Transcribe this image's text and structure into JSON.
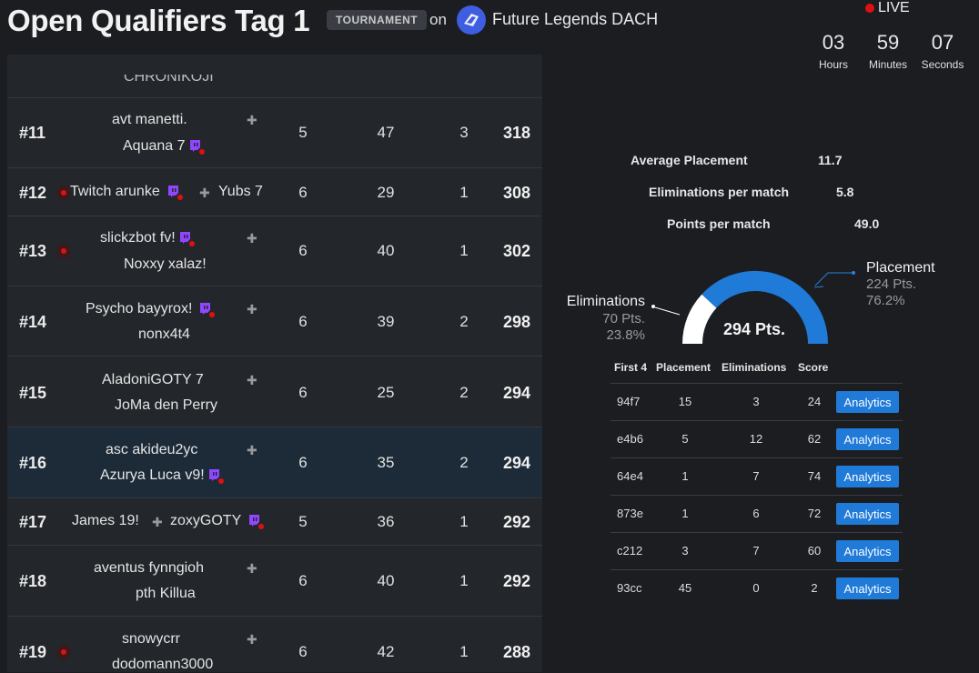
{
  "header": {
    "title": "Open Qualifiers Tag 1",
    "badge": "TOURNAMENT",
    "on_text": "on",
    "org_name": "Future Legends DACH",
    "live_label": "LIVE",
    "countdown": [
      {
        "value": "03",
        "label": "Hours"
      },
      {
        "value": "59",
        "label": "Minutes"
      },
      {
        "value": "07",
        "label": "Seconds"
      }
    ]
  },
  "leaderboard": {
    "partial_top_name": "CHRONIKOJI",
    "rows": [
      {
        "rank": "#11",
        "p1": "avt manetti.",
        "p2": "Aquana 7",
        "col1": "5",
        "col2": "47",
        "col3": "3",
        "score": "318"
      },
      {
        "rank": "#12",
        "p1": "Twitch arunke",
        "p2": "Yubs 7",
        "col1": "6",
        "col2": "29",
        "col3": "1",
        "score": "308"
      },
      {
        "rank": "#13",
        "p1": "slickzbot fv!",
        "p2": "Noxxy xalaz!",
        "col1": "6",
        "col2": "40",
        "col3": "1",
        "score": "302"
      },
      {
        "rank": "#14",
        "p1": "Psycho bayyrox!",
        "p2": "nonx4t4",
        "col1": "6",
        "col2": "39",
        "col3": "2",
        "score": "298"
      },
      {
        "rank": "#15",
        "p1": "AladoniGOTY 7",
        "p2": "JoMa den Perry",
        "col1": "6",
        "col2": "25",
        "col3": "2",
        "score": "294"
      },
      {
        "rank": "#16",
        "p1": "asc akideu2yc",
        "p2": "Azurya Luca v9!",
        "col1": "6",
        "col2": "35",
        "col3": "2",
        "score": "294"
      },
      {
        "rank": "#17",
        "p1": "James 19!",
        "p2": "zoxyGOTY",
        "col1": "5",
        "col2": "36",
        "col3": "1",
        "score": "292"
      },
      {
        "rank": "#18",
        "p1": "aventus fynngioh",
        "p2": "pth Killua",
        "col1": "6",
        "col2": "40",
        "col3": "1",
        "score": "292"
      },
      {
        "rank": "#19",
        "p1": "snowycrr",
        "p2": "dodomann3000",
        "col1": "6",
        "col2": "42",
        "col3": "1",
        "score": "288"
      }
    ]
  },
  "details": {
    "stats": [
      {
        "label": "Average Placement",
        "value": "11.7"
      },
      {
        "label": "Eliminations per match",
        "value": "5.8"
      },
      {
        "label": "Points per match",
        "value": "49.0"
      }
    ],
    "gauge": {
      "total": "294 Pts.",
      "placement_label": "Placement",
      "placement_pts": "224 Pts.",
      "placement_pct": "76.2%",
      "placement_fraction": 0.762,
      "elim_label": "Eliminations",
      "elim_pts": "70 Pts.",
      "elim_pct": "23.8%",
      "placement_color": "#1f7ad8",
      "elim_color": "#ffffff"
    },
    "matches": {
      "headers": [
        "First 4",
        "Placement",
        "Eliminations",
        "Score"
      ],
      "button_label": "Analytics",
      "rows": [
        {
          "id": "94f7",
          "placement": "15",
          "elims": "3",
          "score": "24"
        },
        {
          "id": "e4b6",
          "placement": "5",
          "elims": "12",
          "score": "62"
        },
        {
          "id": "64e4",
          "placement": "1",
          "elims": "7",
          "score": "74"
        },
        {
          "id": "873e",
          "placement": "1",
          "elims": "6",
          "score": "72"
        },
        {
          "id": "c212",
          "placement": "3",
          "elims": "7",
          "score": "60"
        },
        {
          "id": "93cc",
          "placement": "45",
          "elims": "0",
          "score": "2"
        }
      ]
    }
  }
}
